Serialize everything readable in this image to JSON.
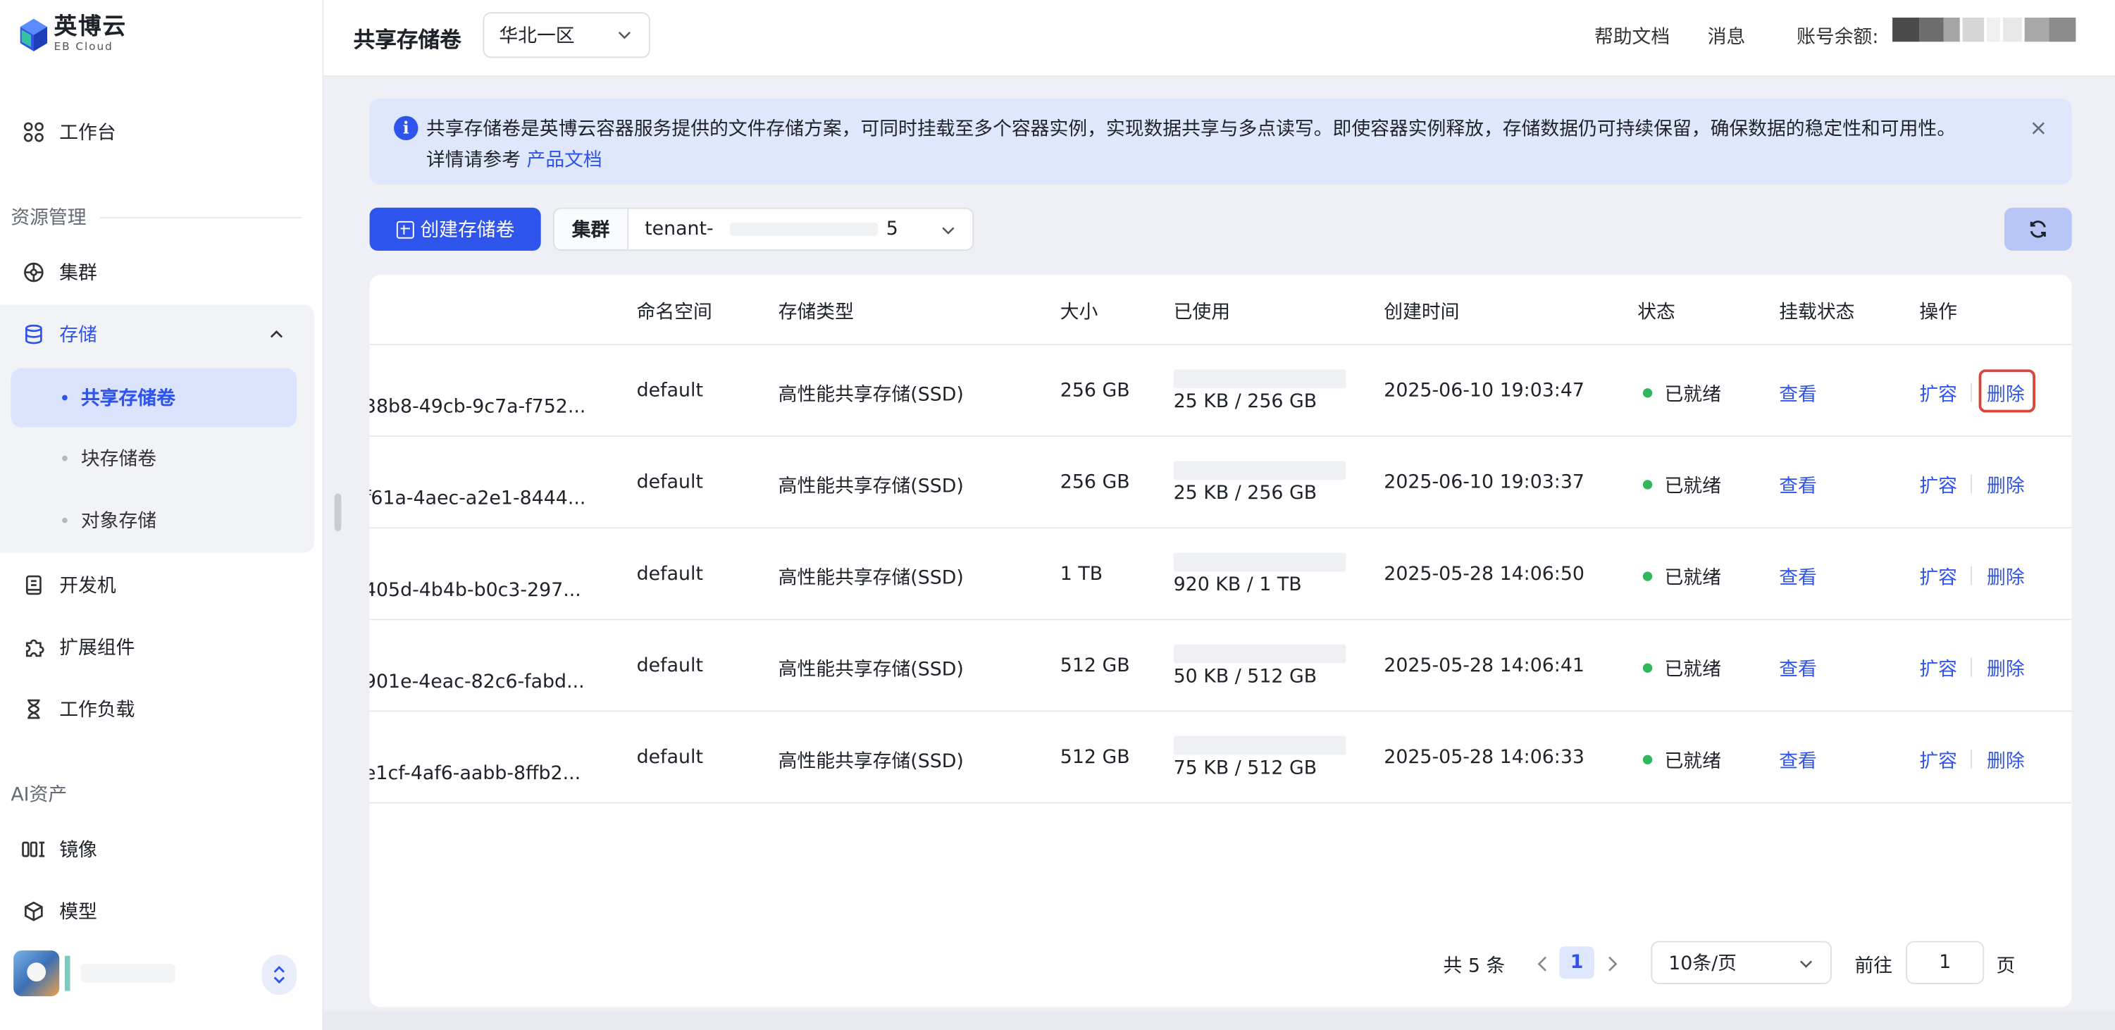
{
  "brand": {
    "name": "英博云",
    "sub": "EB Cloud"
  },
  "sidebar": {
    "workbench": "工作台",
    "section_resources": "资源管理",
    "cluster": "集群",
    "storage": "存储",
    "storage_items": [
      "共享存储卷",
      "块存储卷",
      "对象存储"
    ],
    "devbox": "开发机",
    "extensions": "扩展组件",
    "workloads": "工作负载",
    "section_ai": "AI资产",
    "images": "镜像",
    "models": "模型"
  },
  "header": {
    "title": "共享存储卷",
    "region": "华北一区",
    "help_docs": "帮助文档",
    "messages": "消息",
    "balance_label": "账号余额:"
  },
  "alert": {
    "text": "共享存储卷是英博云容器服务提供的文件存储方案，可同时挂载至多个容器实例，实现数据共享与多点读写。即使容器实例释放，存储数据仍可持续保留，确保数据的稳定性和可用性。",
    "more_prefix": "详情请参考",
    "link": "产品文档",
    "close": "×"
  },
  "toolbar": {
    "create_label": "创建存储卷",
    "cluster_label": "集群",
    "cluster_value": "tenant-",
    "cluster_tail": "5"
  },
  "table": {
    "columns": [
      "命名空间",
      "存储类型",
      "大小",
      "已使用",
      "创建时间",
      "状态",
      "挂载状态",
      "操作"
    ],
    "rows": [
      {
        "name": "38b8-49cb-9c7a-f752...",
        "namespace": "default",
        "type": "高性能共享存储(SSD)",
        "size": "256 GB",
        "used": "25 KB / 256 GB",
        "used_fraction": 0.0001,
        "created": "2025-06-10 19:03:47",
        "status": "已就绪",
        "mount": "查看",
        "expand": "扩容",
        "delete": "删除"
      },
      {
        "name": "f61a-4aec-a2e1-8444...",
        "namespace": "default",
        "type": "高性能共享存储(SSD)",
        "size": "256 GB",
        "used": "25 KB / 256 GB",
        "used_fraction": 0.0001,
        "created": "2025-06-10 19:03:37",
        "status": "已就绪",
        "mount": "查看",
        "expand": "扩容",
        "delete": "删除"
      },
      {
        "name": "405d-4b4b-b0c3-297...",
        "namespace": "default",
        "type": "高性能共享存储(SSD)",
        "size": "1 TB",
        "used": "920 KB / 1 TB",
        "used_fraction": 0.0001,
        "created": "2025-05-28 14:06:50",
        "status": "已就绪",
        "mount": "查看",
        "expand": "扩容",
        "delete": "删除"
      },
      {
        "name": "901e-4eac-82c6-fabd...",
        "namespace": "default",
        "type": "高性能共享存储(SSD)",
        "size": "512 GB",
        "used": "50 KB / 512 GB",
        "used_fraction": 0.0001,
        "created": "2025-05-28 14:06:41",
        "status": "已就绪",
        "mount": "查看",
        "expand": "扩容",
        "delete": "删除"
      },
      {
        "name": "e1cf-4af6-aabb-8ffb2...",
        "namespace": "default",
        "type": "高性能共享存储(SSD)",
        "size": "512 GB",
        "used": "75 KB / 512 GB",
        "used_fraction": 0.0001,
        "created": "2025-05-28 14:06:33",
        "status": "已就绪",
        "mount": "查看",
        "expand": "扩容",
        "delete": "删除"
      }
    ]
  },
  "pagination": {
    "total": "共 5 条",
    "current": "1",
    "page_size": "10条/页",
    "goto_label": "前往",
    "goto_value": "1",
    "page_suffix": "页"
  },
  "colors": {
    "accent": "#2f54eb",
    "success": "#31b65b",
    "highlight": "#d9473b"
  }
}
